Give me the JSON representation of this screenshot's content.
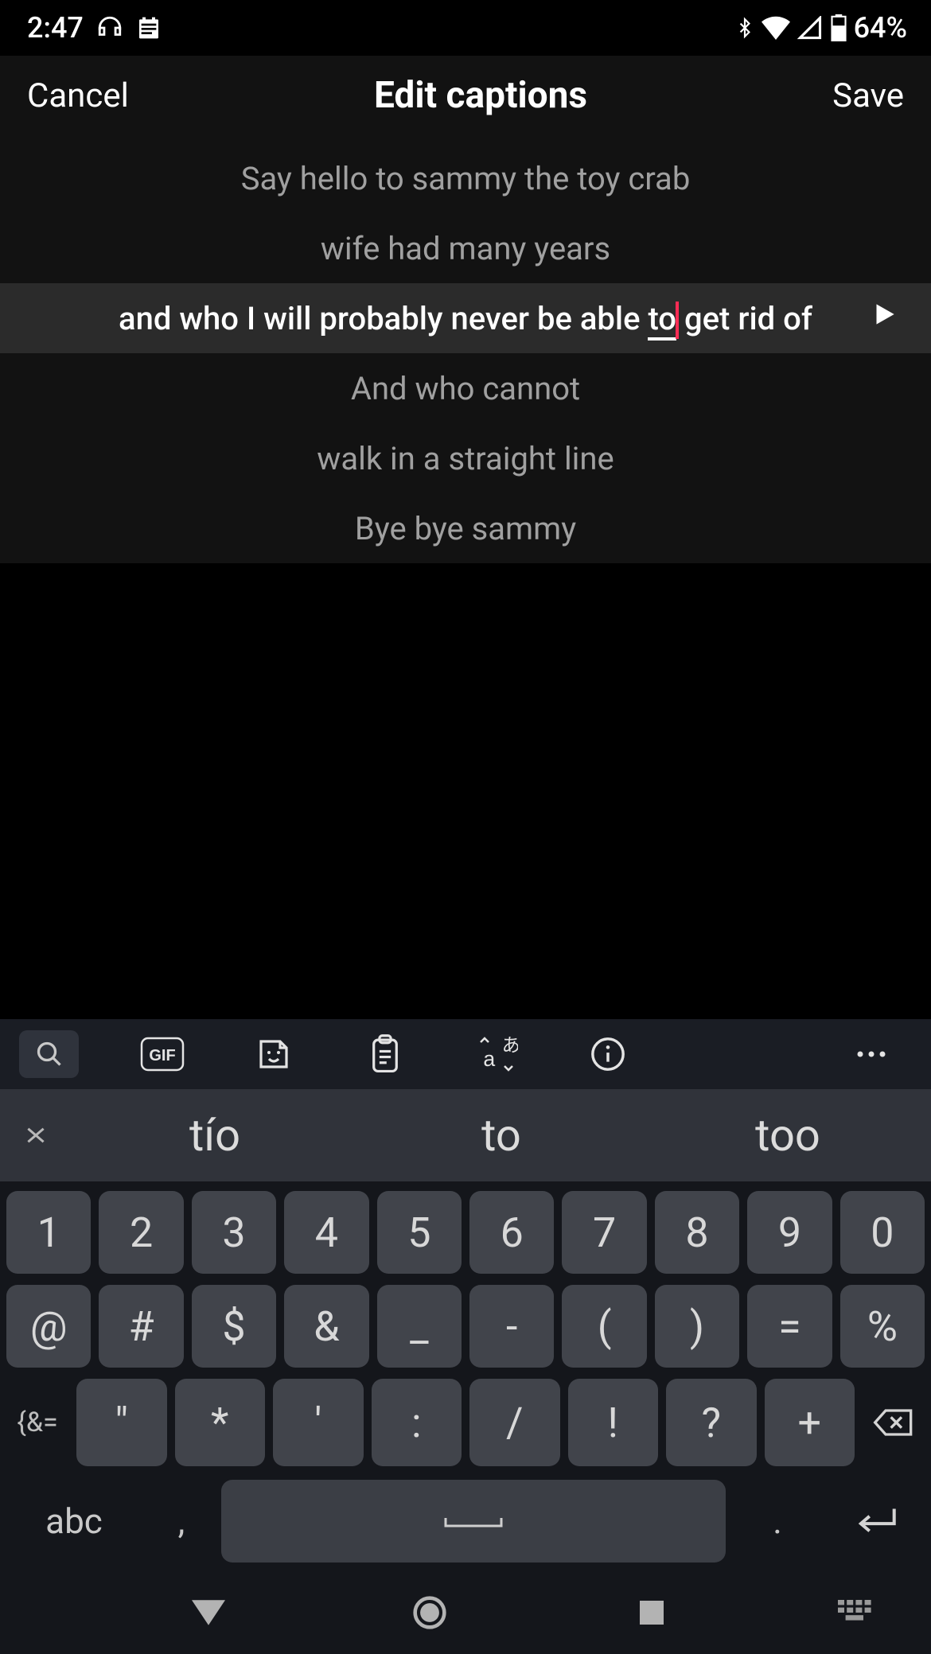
{
  "status": {
    "time": "2:47",
    "battery": "64%",
    "icons_left": [
      "headphones",
      "calendar"
    ],
    "icons_right": [
      "bluetooth",
      "wifi",
      "cell",
      "battery"
    ]
  },
  "header": {
    "cancel": "Cancel",
    "title": "Edit captions",
    "save": "Save"
  },
  "captions": [
    {
      "text": "Say hello to sammy the toy crab",
      "active": false
    },
    {
      "text": "wife had many years",
      "active": false
    },
    {
      "text_before": "and who I will probably never be able ",
      "text_editing": "to",
      "text_after": " get rid of",
      "active": true
    },
    {
      "text": "And who cannot",
      "active": false
    },
    {
      "text": "walk in a straight line",
      "active": false
    },
    {
      "text": "Bye bye sammy",
      "active": false
    }
  ],
  "keyboard": {
    "toolbar": [
      "search",
      "gif",
      "sticker",
      "clipboard",
      "translate",
      "info",
      "more"
    ],
    "gif_label": "GIF",
    "suggestions": [
      "tío",
      "to",
      "too"
    ],
    "row1": [
      "1",
      "2",
      "3",
      "4",
      "5",
      "6",
      "7",
      "8",
      "9",
      "0"
    ],
    "row2": [
      "@",
      "#",
      "$",
      "&",
      "_",
      "-",
      "(",
      ")",
      "=",
      "%"
    ],
    "row3_sym": "{&=",
    "row3": [
      "\"",
      "*",
      "'",
      ":",
      "/",
      "!",
      "?",
      "+"
    ],
    "row4_abc": "abc",
    "row4_comma": ",",
    "row4_period": "."
  },
  "nav": [
    "back",
    "home",
    "recent",
    "keyboard"
  ]
}
